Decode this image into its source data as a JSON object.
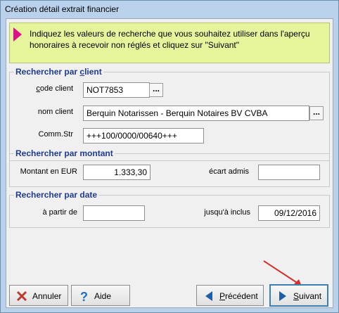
{
  "window": {
    "title": "Création détail extrait financier"
  },
  "info": {
    "message": "Indiquez les valeurs de recherche que vous souhaitez utiliser dans l'aperçu honoraires à recevoir non réglés et cliquez sur \"Suivant\""
  },
  "client_group": {
    "title": "Rechercher par client",
    "code_label": "code client",
    "code_value": "NOT7853",
    "name_label": "nom client",
    "name_value": "Berquin Notarissen - Berquin Notaires BV CVBA",
    "comm_label": "Comm.Str",
    "comm_value": "+++100/0000/00640+++",
    "browse_label": "..."
  },
  "amount_group": {
    "title": "Rechercher par montant",
    "amount_label": "Montant en EUR",
    "amount_value": "1.333,30",
    "gap_label": "écart admis",
    "gap_value": ""
  },
  "date_group": {
    "title": "Rechercher par date",
    "from_label": "à partir de",
    "from_value": "",
    "to_label": "jusqu'à inclus",
    "to_value": "09/12/2016"
  },
  "buttons": {
    "cancel": "Annuler",
    "help": "Aide",
    "previous": "Précédent",
    "next": "Suivant"
  },
  "colors": {
    "accent": "#1f3a93",
    "info_bg": "#e6f49c",
    "info_icon": "#e0108c",
    "arrow": "#d32f2f"
  }
}
